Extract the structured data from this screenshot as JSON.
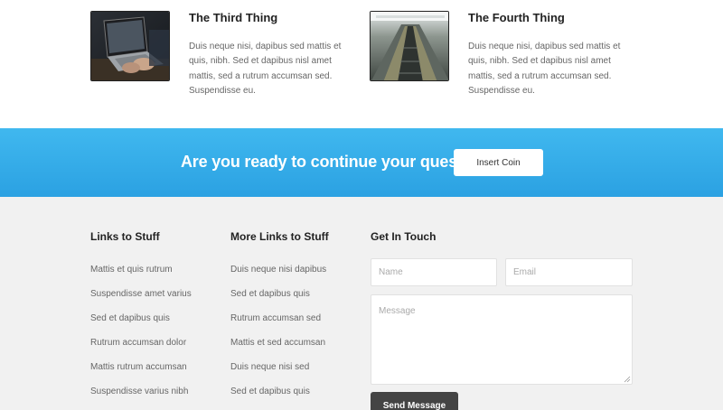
{
  "features": [
    {
      "title": "The Third Thing",
      "body": "Duis neque nisi, dapibus sed mattis et quis, nibh. Sed et dapibus nisl amet mattis, sed a rutrum accumsan sed. Suspendisse eu.",
      "image": "laptop-photo"
    },
    {
      "title": "The Fourth Thing",
      "body": "Duis neque nisi, dapibus sed mattis et quis, nibh. Sed et dapibus nisl amet mattis, sed a rutrum accumsan sed. Suspendisse eu.",
      "image": "escalator-photo"
    }
  ],
  "cta": {
    "text": "Are you ready to continue your quest?",
    "button_label": "Insert Coin"
  },
  "footer": {
    "col1": {
      "title": "Links to Stuff",
      "links": [
        "Mattis et quis rutrum",
        "Suspendisse amet varius",
        "Sed et dapibus quis",
        "Rutrum accumsan dolor",
        "Mattis rutrum accumsan",
        "Suspendisse varius nibh"
      ]
    },
    "col2": {
      "title": "More Links to Stuff",
      "links": [
        "Duis neque nisi dapibus",
        "Sed et dapibus quis",
        "Rutrum accumsan sed",
        "Mattis et sed accumsan",
        "Duis neque nisi sed",
        "Sed et dapibus quis"
      ]
    },
    "contact": {
      "title": "Get In Touch",
      "name_placeholder": "Name",
      "email_placeholder": "Email",
      "message_placeholder": "Message",
      "send_label": "Send Message"
    }
  },
  "colors": {
    "cta_blue": "#39b0eb",
    "footer_bg": "#f1f1f1",
    "send_button": "#444444"
  }
}
